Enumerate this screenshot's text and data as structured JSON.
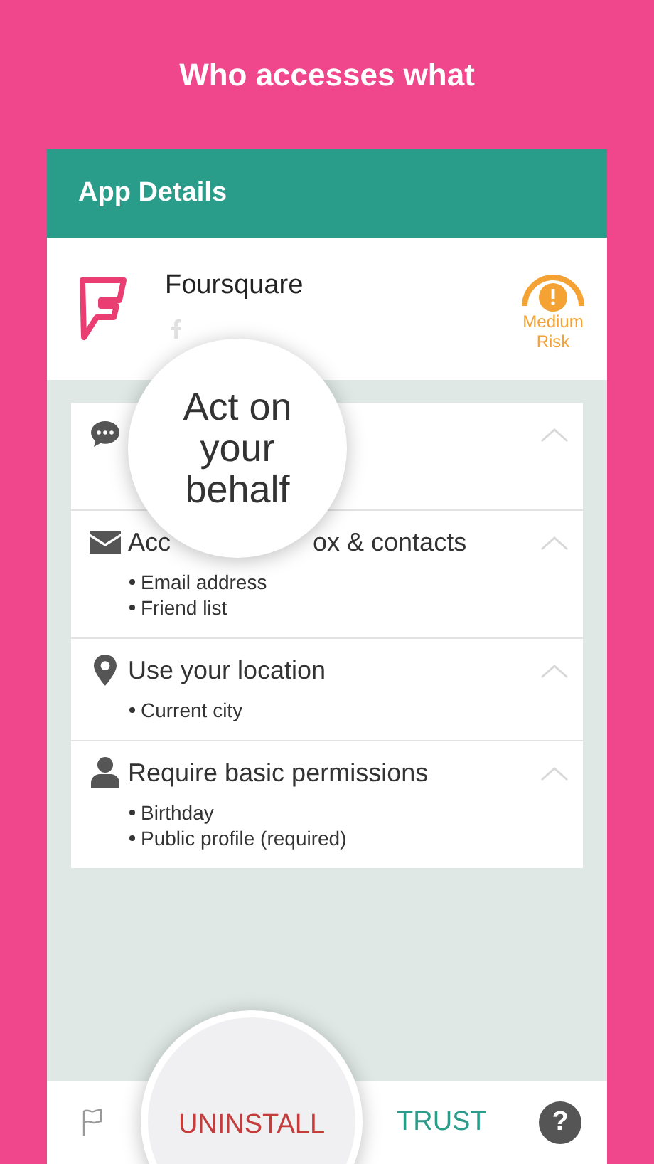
{
  "headline": "Who accesses what",
  "header": {
    "title": "App Details"
  },
  "app": {
    "name": "Foursquare",
    "risk": "Medium\nRisk"
  },
  "magnifier": {
    "text": "Act on\nyour\nbehalf"
  },
  "permissions": [
    {
      "kind": "chat"
    },
    {
      "kind": "mail",
      "title_start": "Acc",
      "title_end": "ox & contacts",
      "items": [
        "Email address",
        "Friend list"
      ]
    },
    {
      "kind": "location",
      "title_start": "Use your location",
      "items": [
        "Current city"
      ]
    },
    {
      "kind": "person",
      "title_start": "Require basic permissions",
      "items": [
        "Birthday",
        "Public profile (required)"
      ]
    }
  ],
  "footer": {
    "uninstall": "UNINSTALL",
    "trust": "TRUST",
    "help": "?"
  }
}
